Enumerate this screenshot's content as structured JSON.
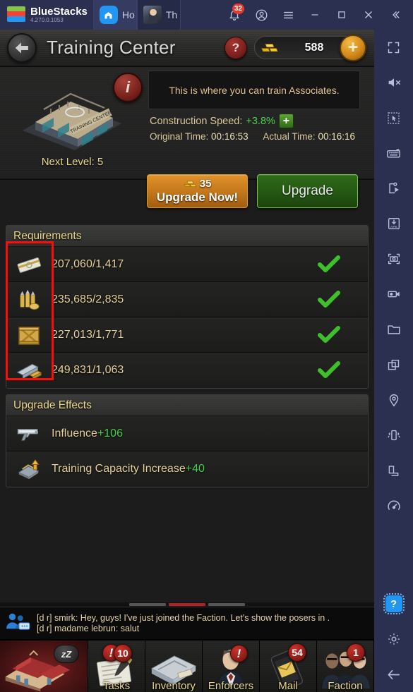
{
  "bluestacks": {
    "brand": "BlueStacks",
    "version": "4.270.0.1053",
    "tabs": [
      {
        "label": "Ho",
        "icon": "home-icon"
      },
      {
        "label": "Th",
        "icon": "game-thumbnail-icon"
      }
    ],
    "notification_count": "32",
    "window_controls": {
      "notifications": "bell-icon",
      "account": "account-icon",
      "menu": "hamburger-menu-icon",
      "minimize": "minimize-icon",
      "maximize": "maximize-icon",
      "close": "close-icon",
      "collapse": "collapse-icon"
    },
    "sidebar": [
      {
        "name": "fullscreen"
      },
      {
        "name": "mute"
      },
      {
        "name": "cursor-select"
      },
      {
        "name": "keyboard-controls"
      },
      {
        "name": "macro-script"
      },
      {
        "name": "install-apk"
      },
      {
        "name": "screenshot"
      },
      {
        "name": "record-video"
      },
      {
        "name": "media-folder"
      },
      {
        "name": "multi-instance"
      },
      {
        "name": "location"
      },
      {
        "name": "shake"
      },
      {
        "name": "rotate"
      },
      {
        "name": "performance"
      }
    ],
    "sidebar_bottom": [
      {
        "name": "help",
        "label": "?"
      },
      {
        "name": "settings"
      },
      {
        "name": "back"
      }
    ]
  },
  "panel": {
    "title": "Training Center",
    "back_icon": "back-arrow-icon",
    "help_label": "?",
    "gold": {
      "icon": "gold-bars-icon",
      "value": "588",
      "add_label": "+"
    }
  },
  "building": {
    "info_icon": "info-icon",
    "description": "This is where you can train Associates.",
    "next_level_label": "Next Level: 5",
    "construction_speed_label": "Construction Speed:",
    "construction_speed_value": "+3.8%",
    "speed_boost_button": "+",
    "original_time_label": "Original Time:",
    "original_time_value": "00:16:53",
    "actual_time_label": "Actual Time:",
    "actual_time_value": "00:16:16",
    "upgrade_now": {
      "cost": "35",
      "cost_icon": "gold-bars-icon",
      "label": "Upgrade Now!"
    },
    "upgrade_label": "Upgrade"
  },
  "requirements": {
    "header": "Requirements",
    "rows": [
      {
        "icon": "cash-icon",
        "amount": "207,060/1,417",
        "status": "check-icon"
      },
      {
        "icon": "ammo-icon",
        "amount": "235,685/2,835",
        "status": "check-icon"
      },
      {
        "icon": "crate-icon",
        "amount": "227,013/1,771",
        "status": "check-icon"
      },
      {
        "icon": "metal-icon",
        "amount": "249,831/1,063",
        "status": "check-icon"
      }
    ]
  },
  "upgrade_effects": {
    "header": "Upgrade Effects",
    "rows": [
      {
        "icon": "pistol-icon",
        "label": "Influence",
        "value": "+106"
      },
      {
        "icon": "building-icon",
        "label": "Training Capacity Increase",
        "value": "+40"
      }
    ]
  },
  "chat": {
    "icon": "chat-group-icon",
    "lines": [
      "[d r] smirk: Hey, guys! I've just joined the Faction. Let's show the posers in .",
      "[d r] madame lebrun: salut"
    ],
    "tabs": [
      {
        "active": false
      },
      {
        "active": true
      },
      {
        "active": false
      }
    ]
  },
  "bottom_nav": [
    {
      "name": "home",
      "label": "",
      "badge_excl": false,
      "badge_num": "",
      "sleep": "zZ"
    },
    {
      "name": "tasks",
      "label": "Tasks",
      "badge_excl": true,
      "badge_num": "10",
      "sleep": ""
    },
    {
      "name": "inventory",
      "label": "Inventory",
      "badge_excl": false,
      "badge_num": "",
      "sleep": ""
    },
    {
      "name": "enforcers",
      "label": "Enforcers",
      "badge_excl": true,
      "badge_num": "",
      "sleep": ""
    },
    {
      "name": "mail",
      "label": "Mail",
      "badge_excl": false,
      "badge_num": "54",
      "sleep": ""
    },
    {
      "name": "faction",
      "label": "Faction",
      "badge_excl": false,
      "badge_num": "1",
      "sleep": ""
    }
  ],
  "colors": {
    "bluestacks_bg": "#2b3050",
    "accent_blue": "#2196f3",
    "badge_red": "#e8392e",
    "gold_text": "#ecd98c",
    "green_positive": "#49d14c",
    "annotation_red": "#fb0d0d"
  }
}
